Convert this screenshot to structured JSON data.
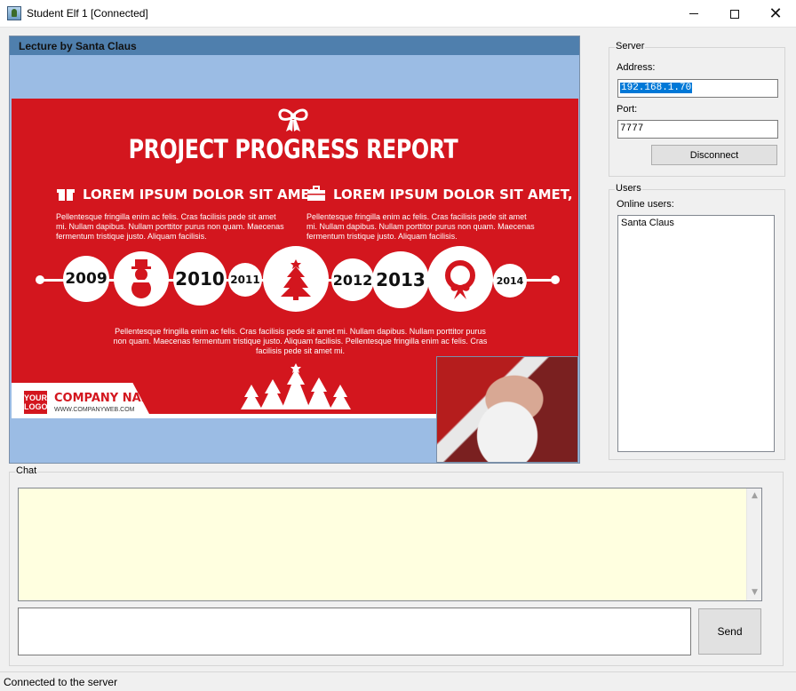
{
  "window": {
    "title": "Student Elf 1 [Connected]",
    "minimize": "minimize",
    "maximize": "maximize",
    "close": "✕"
  },
  "lecture": {
    "title": "Lecture by Santa Claus",
    "slide": {
      "title": "PROJECT PROGRESS REPORT",
      "col1_head": "LOREM IPSUM DOLOR SIT AMET,",
      "col1_body": "Pellentesque fringilla enim ac felis. Cras facilisis pede sit amet mi. Nullam dapibus. Nullam porttitor purus non quam. Maecenas fermentum tristique justo. Aliquam facilisis.",
      "col2_head": "LOREM IPSUM DOLOR SIT AMET,",
      "col2_body": "Pellentesque fringilla enim ac felis. Cras facilisis pede sit amet mi. Nullam dapibus. Nullam porttitor purus non quam. Maecenas fermentum tristique justo. Aliquam facilisis.",
      "years": [
        "2009",
        "2010",
        "2011",
        "2012",
        "2013",
        "2014"
      ],
      "bottom_text": "Pellentesque fringilla enim ac felis. Cras facilisis pede sit amet mi. Nullam dapibus. Nullam porttitor purus non quam. Maecenas fermentum tristique justo. Aliquam facilisis. Pellentesque fringilla enim ac felis. Cras facilisis pede sit amet mi.",
      "logo_line1": "YOUR",
      "logo_line2": "LOGO",
      "company_name": "COMPANY NAME",
      "company_web": "WWW.COMPANYWEB.COM"
    }
  },
  "server": {
    "group_label": "Server",
    "address_label": "Address:",
    "address_value": "192.168.1.70",
    "port_label": "Port:",
    "port_value": "7777",
    "disconnect_label": "Disconnect"
  },
  "users": {
    "group_label": "Users",
    "online_label": "Online users:",
    "list": [
      "Santa Claus"
    ]
  },
  "chat": {
    "group_label": "Chat",
    "input_value": "",
    "send_label": "Send"
  },
  "status": {
    "text": "Connected to the server"
  },
  "colors": {
    "slide_red": "#d3161e",
    "chat_bg": "#ffffe0",
    "header_blue": "#4f7fad",
    "panel_blue": "#9bbce4"
  }
}
